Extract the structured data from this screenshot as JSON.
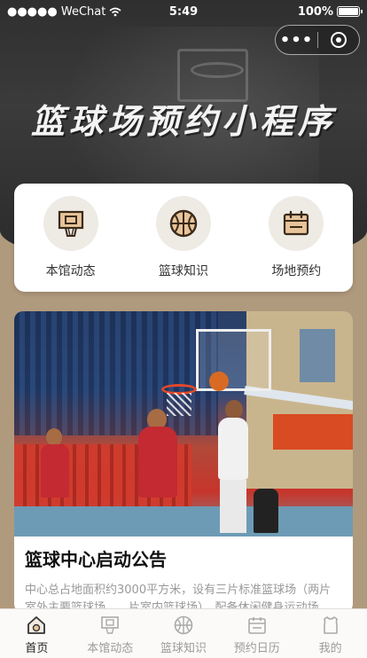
{
  "status_bar": {
    "carrier": "●●●●● WeChat",
    "time": "5:49",
    "battery_text": "100%",
    "battery_level": 1.0
  },
  "capsule": {
    "more_icon": "more-dots-icon",
    "close_icon": "close-circle-icon"
  },
  "hero": {
    "title": "篮球场预约小程序"
  },
  "quick_menu": [
    {
      "label": "本馆动态",
      "icon": "backboard-icon"
    },
    {
      "label": "篮球知识",
      "icon": "basketball-icon"
    },
    {
      "label": "场地预约",
      "icon": "calendar-icon"
    }
  ],
  "news": {
    "title": "篮球中心启动公告",
    "description": "中心总占地面积约3000平方米，设有三片标准篮球场（两片室外主要篮球场……片室内篮球场），配备休闲健身运动场"
  },
  "tabbar": {
    "items": [
      {
        "label": "首页",
        "icon": "home-icon",
        "active": true
      },
      {
        "label": "本馆动态",
        "icon": "backboard-icon",
        "active": false
      },
      {
        "label": "篮球知识",
        "icon": "basketball-icon",
        "active": false
      },
      {
        "label": "预约日历",
        "icon": "calendar-icon",
        "active": false
      },
      {
        "label": "我的",
        "icon": "jersey-icon",
        "active": false
      }
    ]
  },
  "colors": {
    "accent": "#b09a7d",
    "icon_stroke": "#3a2a1a",
    "icon_fill": "#e8c49a"
  }
}
